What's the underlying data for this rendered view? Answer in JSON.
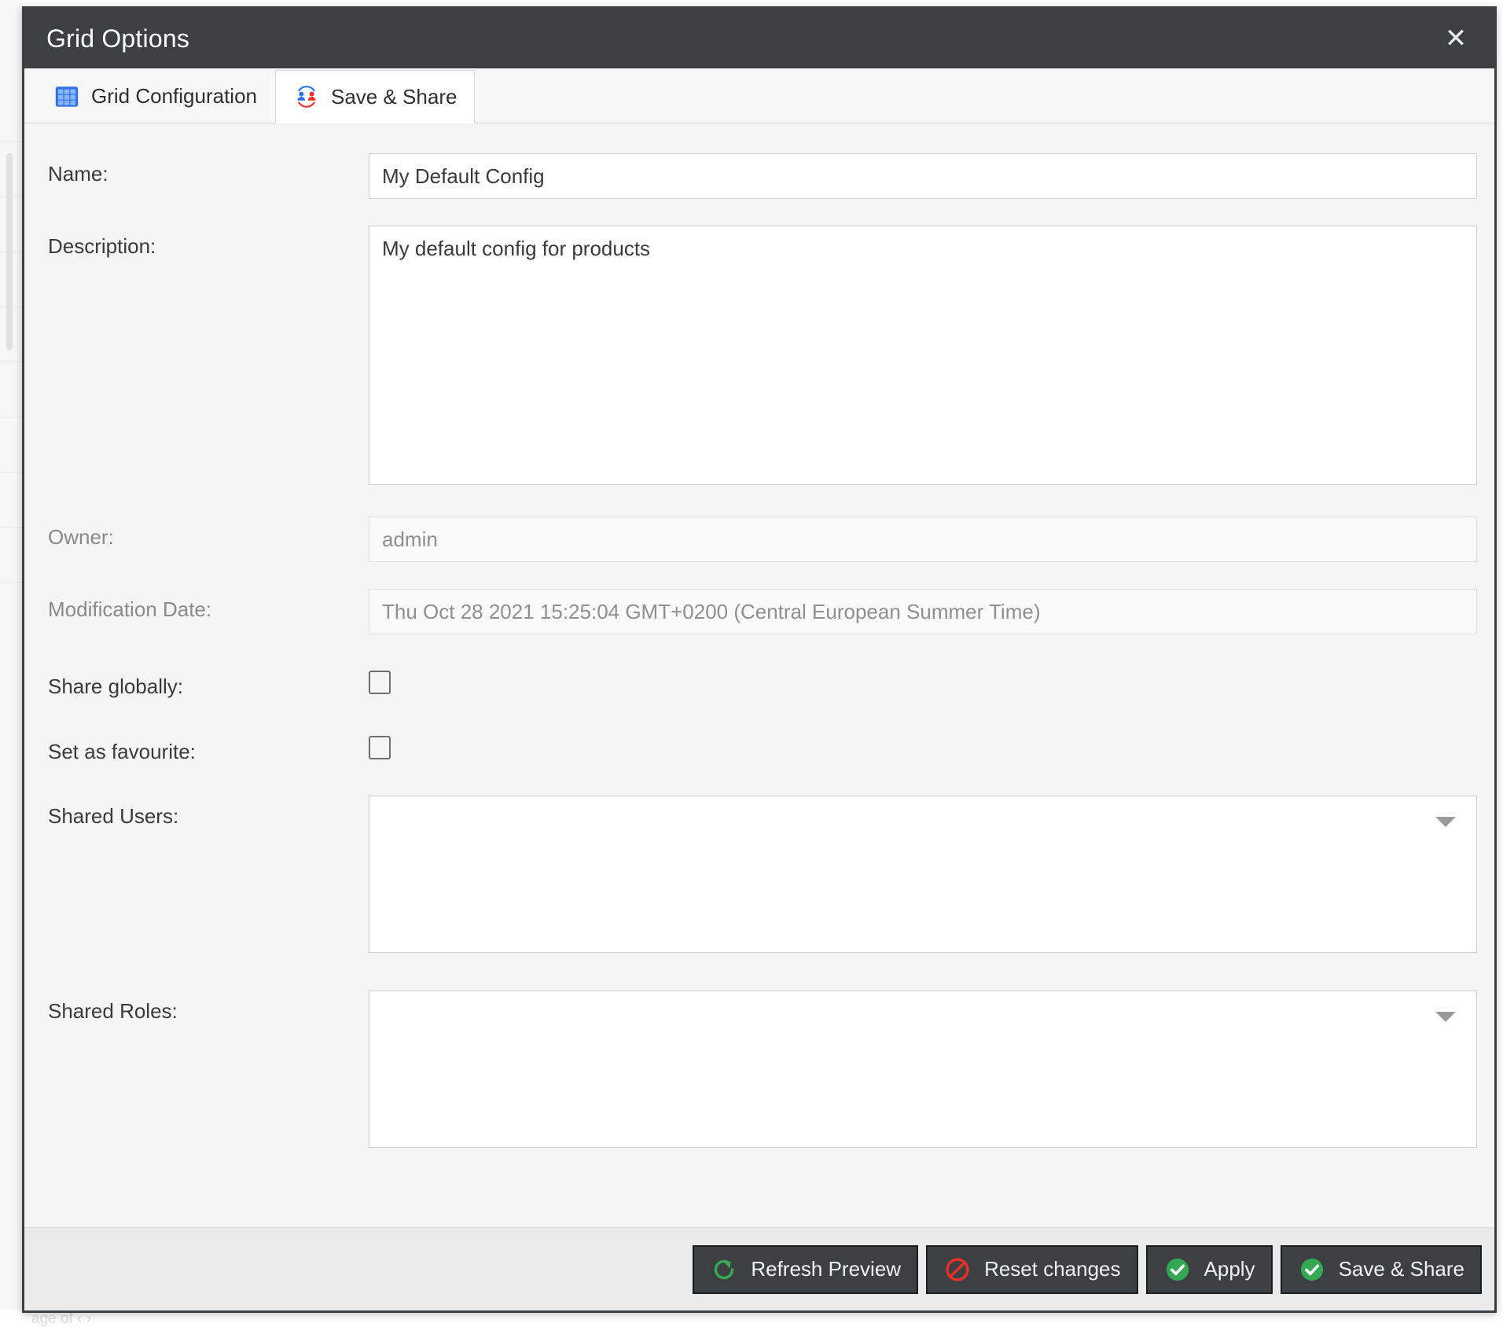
{
  "window": {
    "title": "Grid Options",
    "close_label": "✕",
    "close_icon": "close-icon"
  },
  "tabs": [
    {
      "label": "Grid Configuration",
      "icon": "grid-icon",
      "active": false
    },
    {
      "label": "Save & Share",
      "icon": "share-users-icon",
      "active": true
    }
  ],
  "form": {
    "name": {
      "label": "Name:",
      "value": "My Default Config",
      "placeholder": ""
    },
    "description": {
      "label": "Description:",
      "value": "My default config for products",
      "placeholder": ""
    },
    "owner": {
      "label": "Owner:",
      "value": "admin",
      "readonly": true
    },
    "modification_date": {
      "label": "Modification Date:",
      "value": "Thu Oct 28 2021 15:25:04 GMT+0200 (Central European Summer Time)",
      "readonly": true
    },
    "share_globally": {
      "label": "Share globally:",
      "checked": false
    },
    "set_as_favourite": {
      "label": "Set as favourite:",
      "checked": false
    },
    "shared_users": {
      "label": "Shared Users:",
      "selected": "",
      "options": []
    },
    "shared_roles": {
      "label": "Shared Roles:",
      "selected": "",
      "options": []
    }
  },
  "footer": {
    "buttons": [
      {
        "label": "Refresh Preview",
        "icon": "refresh-icon",
        "color": "#3aa757"
      },
      {
        "label": "Reset changes",
        "icon": "block-icon",
        "color": "#e8312a"
      },
      {
        "label": "Apply",
        "icon": "check-circle-icon",
        "color": "#34a853"
      },
      {
        "label": "Save & Share",
        "icon": "check-circle-icon",
        "color": "#34a853"
      }
    ]
  },
  "colors": {
    "titlebar_bg": "#3c4043",
    "body_bg": "#f5f5f5",
    "footer_bg": "#eaeaea",
    "tab_active_bg": "#ffffff",
    "accent_blue": "#2f72e8",
    "accent_red": "#e8312a",
    "accent_green": "#34a853"
  },
  "backdrop": {
    "ghost_text": "age                  of        ‹  ›"
  }
}
